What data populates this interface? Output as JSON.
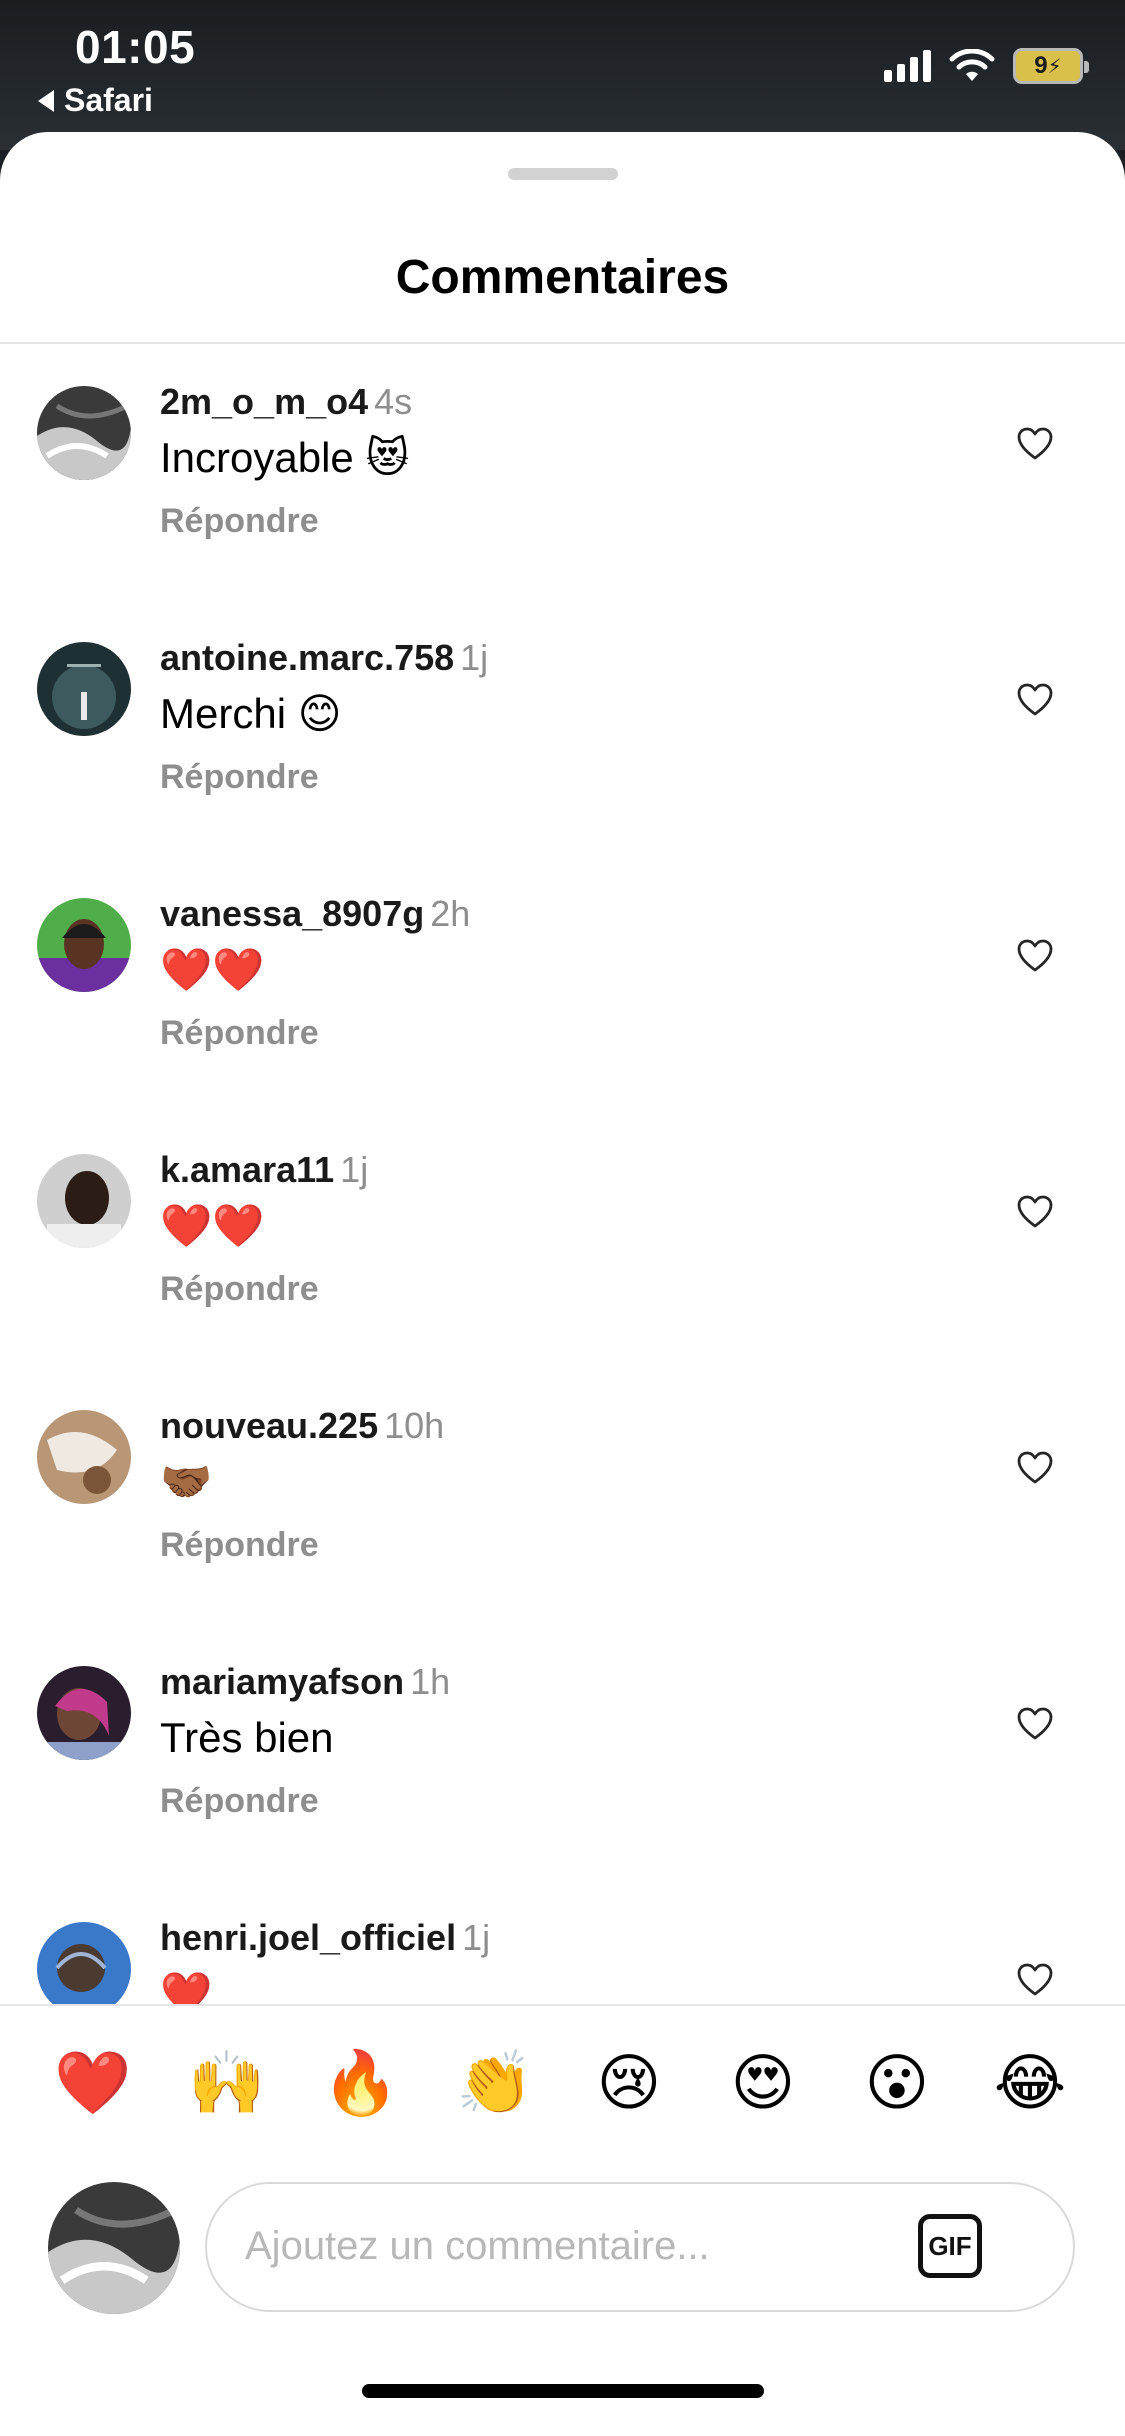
{
  "status": {
    "time": "01:05",
    "back_app": "Safari",
    "battery": "9"
  },
  "sheet": {
    "title": "Commentaires"
  },
  "comments": [
    {
      "user": "2m_o_m_o4",
      "time": "4s",
      "text": "Incroyable 😻",
      "reply": "Répondre"
    },
    {
      "user": "antoine.marc.758",
      "time": "1j",
      "text": "Merchi 😊",
      "reply": "Répondre"
    },
    {
      "user": "vanessa_8907g",
      "time": "2h",
      "text": "❤️❤️",
      "reply": "Répondre"
    },
    {
      "user": "k.amara11",
      "time": "1j",
      "text": "❤️❤️",
      "reply": "Répondre"
    },
    {
      "user": "nouveau.225",
      "time": "10h",
      "text": "🤝🏾",
      "reply": "Répondre"
    },
    {
      "user": "mariamyafson",
      "time": "1h",
      "text": "Très bien",
      "reply": "Répondre"
    },
    {
      "user": "henri.joel_officiel",
      "time": "1j",
      "text": "❤️",
      "reply": ""
    }
  ],
  "emoji_bar": [
    "❤️",
    "🙌",
    "🔥",
    "👏",
    "😢",
    "😍",
    "😮",
    "😂"
  ],
  "input": {
    "placeholder": "Ajoutez un commentaire...",
    "gif_label": "GIF"
  },
  "icons": {
    "heart": "heart-outline-icon",
    "gif": "gif-icon"
  }
}
